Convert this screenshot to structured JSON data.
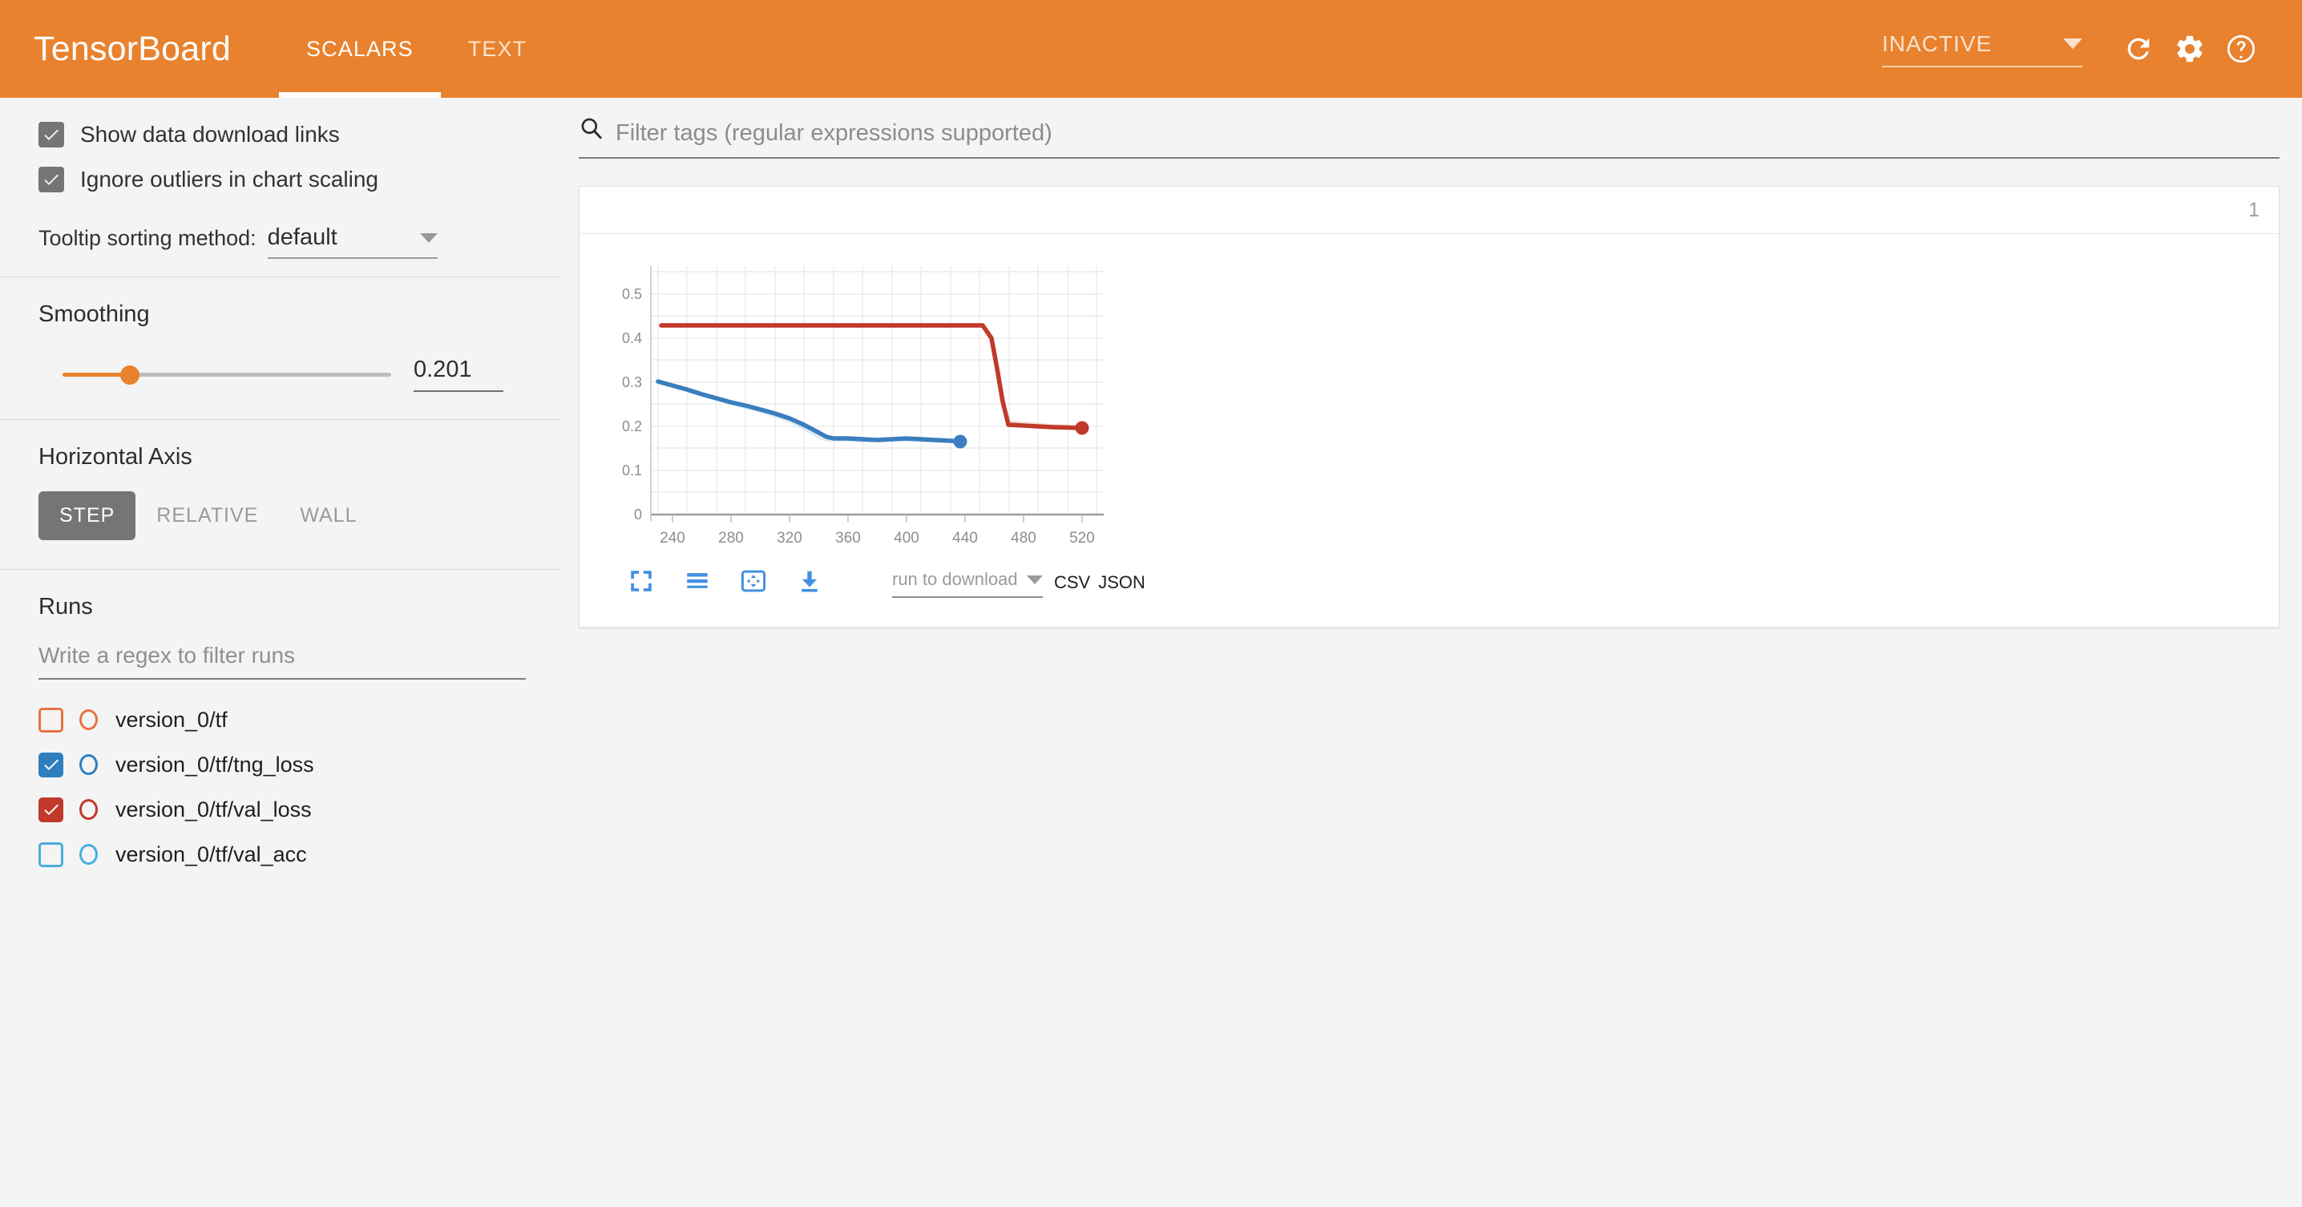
{
  "appbar": {
    "brand": "TensorBoard",
    "tabs": [
      {
        "label": "SCALARS",
        "active": true
      },
      {
        "label": "TEXT",
        "active": false
      }
    ],
    "run_selector_value": "INACTIVE",
    "icons": {
      "refresh": "refresh-icon",
      "settings": "gear-icon",
      "help": "help-circle-icon"
    }
  },
  "sidebar": {
    "checkboxes": [
      {
        "label": "Show data download links",
        "checked": true
      },
      {
        "label": "Ignore outliers in chart scaling",
        "checked": true
      }
    ],
    "tooltip_sorting": {
      "label": "Tooltip sorting method:",
      "value": "default"
    },
    "smoothing": {
      "title": "Smoothing",
      "value": "0.201"
    },
    "horizontal_axis": {
      "title": "Horizontal Axis",
      "options": [
        {
          "label": "STEP",
          "active": true
        },
        {
          "label": "RELATIVE",
          "active": false
        },
        {
          "label": "WALL",
          "active": false
        }
      ]
    },
    "runs": {
      "title": "Runs",
      "filter_placeholder": "Write a regex to filter runs",
      "items": [
        {
          "name": "version_0/tf",
          "checked": false,
          "color": "#e8733f"
        },
        {
          "name": "version_0/tf/tng_loss",
          "checked": true,
          "color": "#2f7fbf"
        },
        {
          "name": "version_0/tf/val_loss",
          "checked": true,
          "color": "#c0392b"
        },
        {
          "name": "version_0/tf/val_acc",
          "checked": false,
          "color": "#49aee0"
        }
      ]
    }
  },
  "main": {
    "search_placeholder": "Filter tags (regular expressions supported)",
    "card": {
      "count": "1",
      "toolbar": {
        "icons": [
          "fullscreen-icon",
          "data-table-icon",
          "pan-icon",
          "download-icon"
        ],
        "download_run_placeholder": "run to download",
        "download_links": [
          "CSV",
          "JSON"
        ]
      }
    }
  },
  "chart_data": {
    "type": "line",
    "title": "",
    "xlabel": "",
    "ylabel": "",
    "xlim": [
      225,
      535
    ],
    "ylim": [
      0,
      0.56
    ],
    "xticks": [
      240,
      280,
      320,
      360,
      400,
      440,
      480,
      520
    ],
    "yticks": [
      0,
      0.1,
      0.2,
      0.3,
      0.4,
      0.5
    ],
    "ytick_labels": [
      "0",
      "0.1",
      "0.2",
      "0.3",
      "0.4",
      "0.5"
    ],
    "grid": true,
    "minor_grid_x_step": 20,
    "minor_grid_y_step": 0.05,
    "legend": "none",
    "series": [
      {
        "name": "version_0/tf/tng_loss",
        "color": "#3a7ebf",
        "endpoint_marker": true,
        "x": [
          230,
          240,
          250,
          260,
          270,
          280,
          290,
          300,
          310,
          320,
          330,
          340,
          345,
          350,
          360,
          370,
          380,
          390,
          400,
          410,
          420,
          430,
          437
        ],
        "y": [
          0.3,
          0.291,
          0.282,
          0.272,
          0.263,
          0.254,
          0.246,
          0.237,
          0.228,
          0.218,
          0.203,
          0.186,
          0.173,
          0.17,
          0.17,
          0.168,
          0.167,
          0.17,
          0.17,
          0.168,
          0.166,
          0.165,
          0.164
        ]
      },
      {
        "name": "version_0/tf/val_loss",
        "color": "#c0392b",
        "endpoint_marker": true,
        "x": [
          232,
          280,
          320,
          360,
          400,
          440,
          452,
          458,
          462,
          466,
          470,
          480,
          500,
          520
        ],
        "y": [
          0.428,
          0.428,
          0.428,
          0.428,
          0.428,
          0.428,
          0.428,
          0.4,
          0.33,
          0.255,
          0.208,
          0.203,
          0.197,
          0.195
        ]
      }
    ]
  }
}
